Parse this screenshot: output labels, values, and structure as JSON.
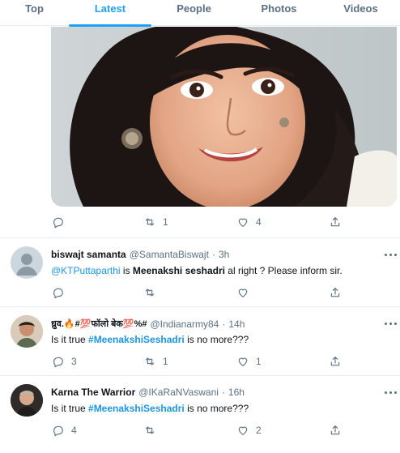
{
  "tabs": [
    {
      "label": "Top"
    },
    {
      "label": "Latest",
      "active": true
    },
    {
      "label": "People"
    },
    {
      "label": "Photos"
    },
    {
      "label": "Videos"
    }
  ],
  "media_tweet": {
    "reply_count": "",
    "retweet_count": "1",
    "like_count": "4"
  },
  "tweets": [
    {
      "name": "biswajt samanta",
      "handle": "@SamantaBiswajt",
      "dot": "·",
      "time": "3h",
      "mention": "@KTPuttaparthi",
      "text_pre": " is ",
      "bold_text": "Meenakshi seshadri",
      "text_post": " al right ? Please inform sir.",
      "reply_count": "",
      "retweet_count": "",
      "like_count": ""
    },
    {
      "name": "ध्रुव.🔥#💯फॉलो बेक💯%#",
      "handle": "@Indianarmy84",
      "dot": "·",
      "time": "14h",
      "text_pre": "Is it true ",
      "hashtag": "#MeenakshiSeshadri",
      "text_post": " is no more???",
      "reply_count": "3",
      "retweet_count": "1",
      "like_count": "1"
    },
    {
      "name": "Karna The Warrior",
      "handle": "@IKaRaNVaswani",
      "dot": "·",
      "time": "16h",
      "text_pre": "Is it true ",
      "hashtag": "#MeenakshiSeshadri",
      "text_post": " is no more???",
      "reply_count": "4",
      "retweet_count": "",
      "like_count": "2"
    }
  ],
  "colors": {
    "accent": "#1da1f2",
    "link": "#1b95e0",
    "muted": "#5b7083",
    "divider": "#e6ecf0"
  },
  "icons": [
    "reply-icon",
    "retweet-icon",
    "like-icon",
    "share-icon",
    "more-icon"
  ]
}
